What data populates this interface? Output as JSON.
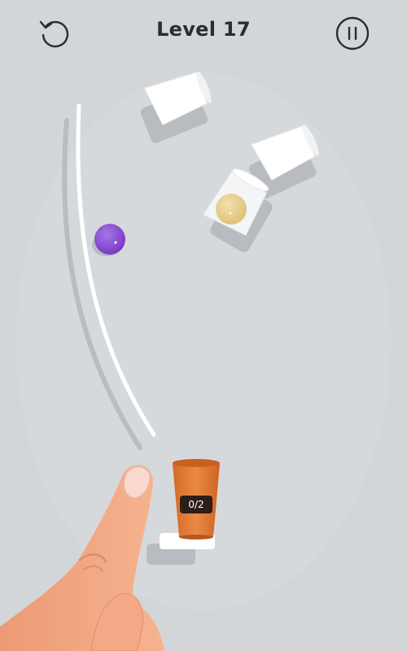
{
  "header": {
    "title": "Level 17",
    "restart_icon": "restart-icon",
    "pause_icon": "pause-icon"
  },
  "game": {
    "cup_counter": "0/2",
    "balls_collected": 0,
    "balls_required": 2
  },
  "colors": {
    "background": "#d3d6d9",
    "target_cup": "#e07a34",
    "ball_purple": "#8a4bd1",
    "ball_yellow": "#e9d08f",
    "white_cup": "#ffffff",
    "finger_skin": "#f0a47f"
  }
}
